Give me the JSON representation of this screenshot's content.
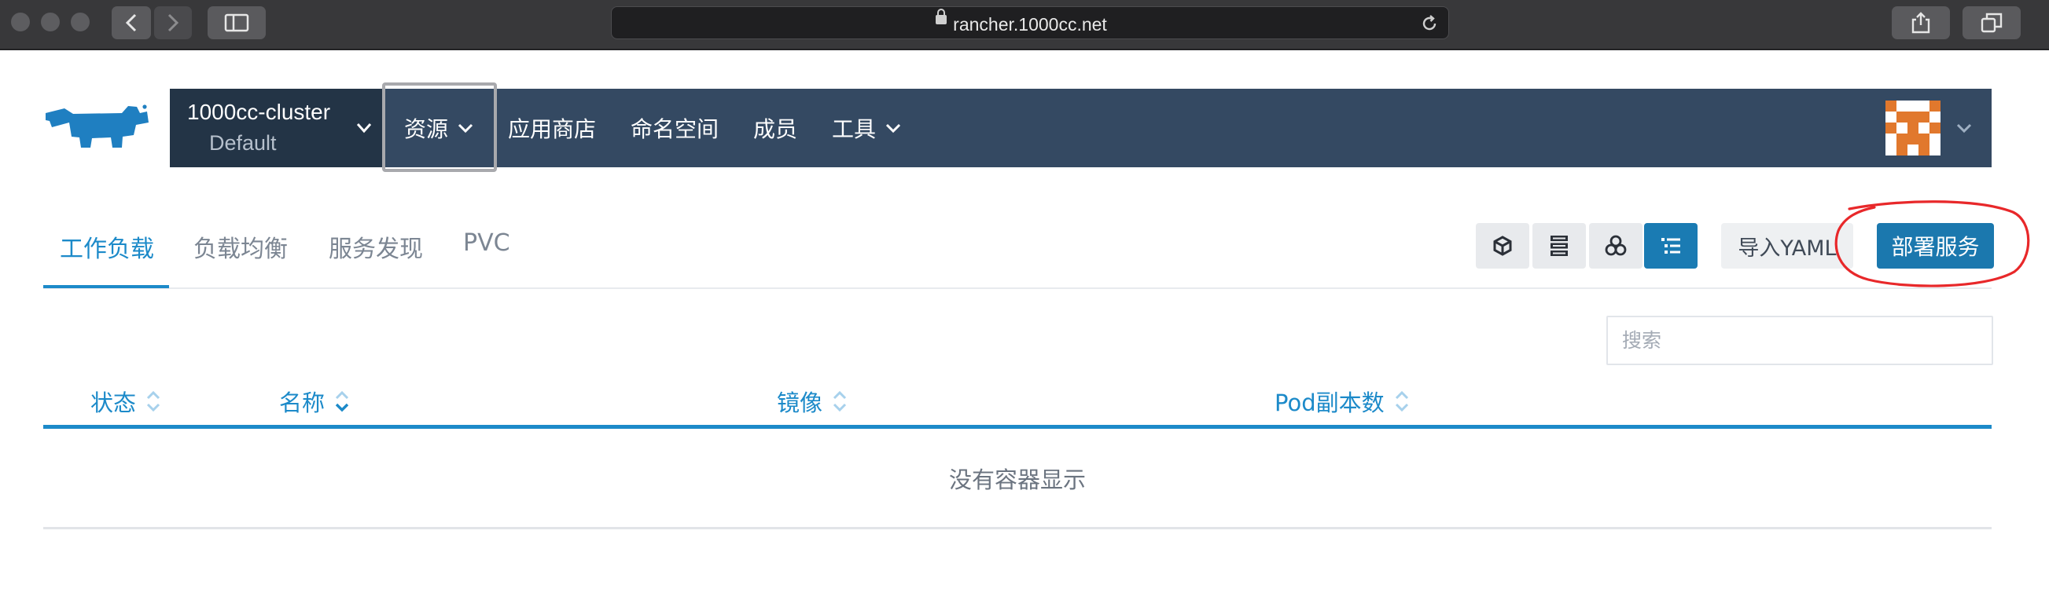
{
  "browser": {
    "url": "rancher.1000cc.net"
  },
  "header": {
    "cluster_name": "1000cc-cluster",
    "project_name": "Default",
    "nav": [
      {
        "label": "资源",
        "has_dropdown": true,
        "active": true
      },
      {
        "label": "应用商店",
        "has_dropdown": false
      },
      {
        "label": "命名空间",
        "has_dropdown": false
      },
      {
        "label": "成员",
        "has_dropdown": false
      },
      {
        "label": "工具",
        "has_dropdown": true
      }
    ]
  },
  "tabs": [
    {
      "label": "工作负载",
      "active": true
    },
    {
      "label": "负载均衡",
      "active": false
    },
    {
      "label": "服务发现",
      "active": false
    },
    {
      "label": "PVC",
      "active": false
    }
  ],
  "toolbar": {
    "view_icons": [
      "cube-icon",
      "server-list-icon",
      "node-group-icon",
      "list-icon"
    ],
    "import_label": "导入YAML",
    "deploy_label": "部署服务"
  },
  "search": {
    "placeholder": "搜索"
  },
  "table": {
    "columns": [
      "状态",
      "名称",
      "镜像",
      "Pod副本数"
    ],
    "empty_message": "没有容器显示"
  },
  "colors": {
    "accent": "#1c8ac9",
    "header_bg": "#344962",
    "cluster_bg": "#233446",
    "primary_button": "#1b78ae",
    "annotation": "#e8282a"
  }
}
